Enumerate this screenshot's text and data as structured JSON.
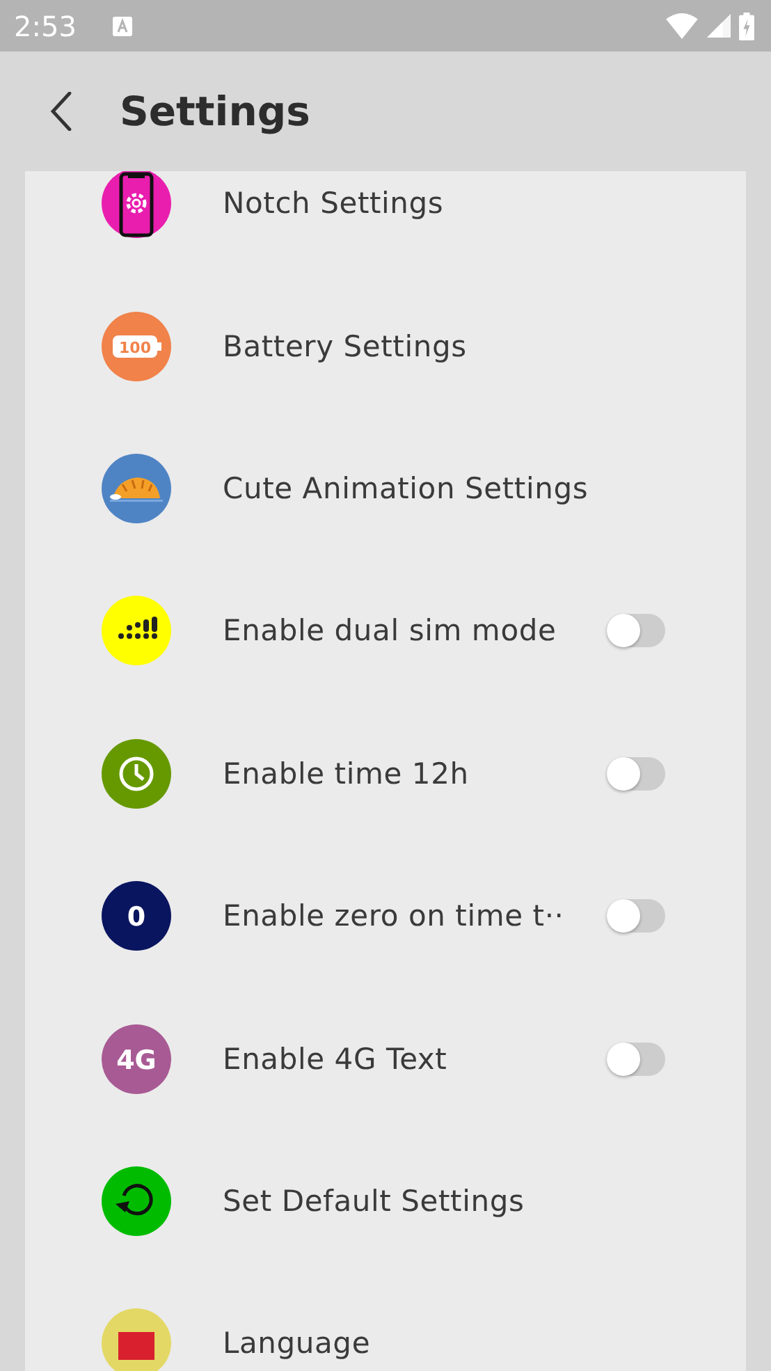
{
  "status_bar": {
    "time": "2:53"
  },
  "app_bar": {
    "title": "Settings"
  },
  "items": [
    {
      "kind": "link",
      "label": "Notch Settings"
    },
    {
      "kind": "link",
      "label": "Battery Settings",
      "badge": "100"
    },
    {
      "kind": "link",
      "label": "Cute Animation Settings"
    },
    {
      "kind": "toggle",
      "label": "Enable dual sim mode",
      "on": false
    },
    {
      "kind": "toggle",
      "label": "Enable time 12h",
      "on": false
    },
    {
      "kind": "toggle",
      "label": "Enable zero on time t··",
      "on": false,
      "badge": "0"
    },
    {
      "kind": "toggle",
      "label": "Enable 4G Text",
      "on": false,
      "badge": "4G"
    },
    {
      "kind": "link",
      "label": "Set Default Settings"
    },
    {
      "kind": "link",
      "label": "Language"
    }
  ]
}
